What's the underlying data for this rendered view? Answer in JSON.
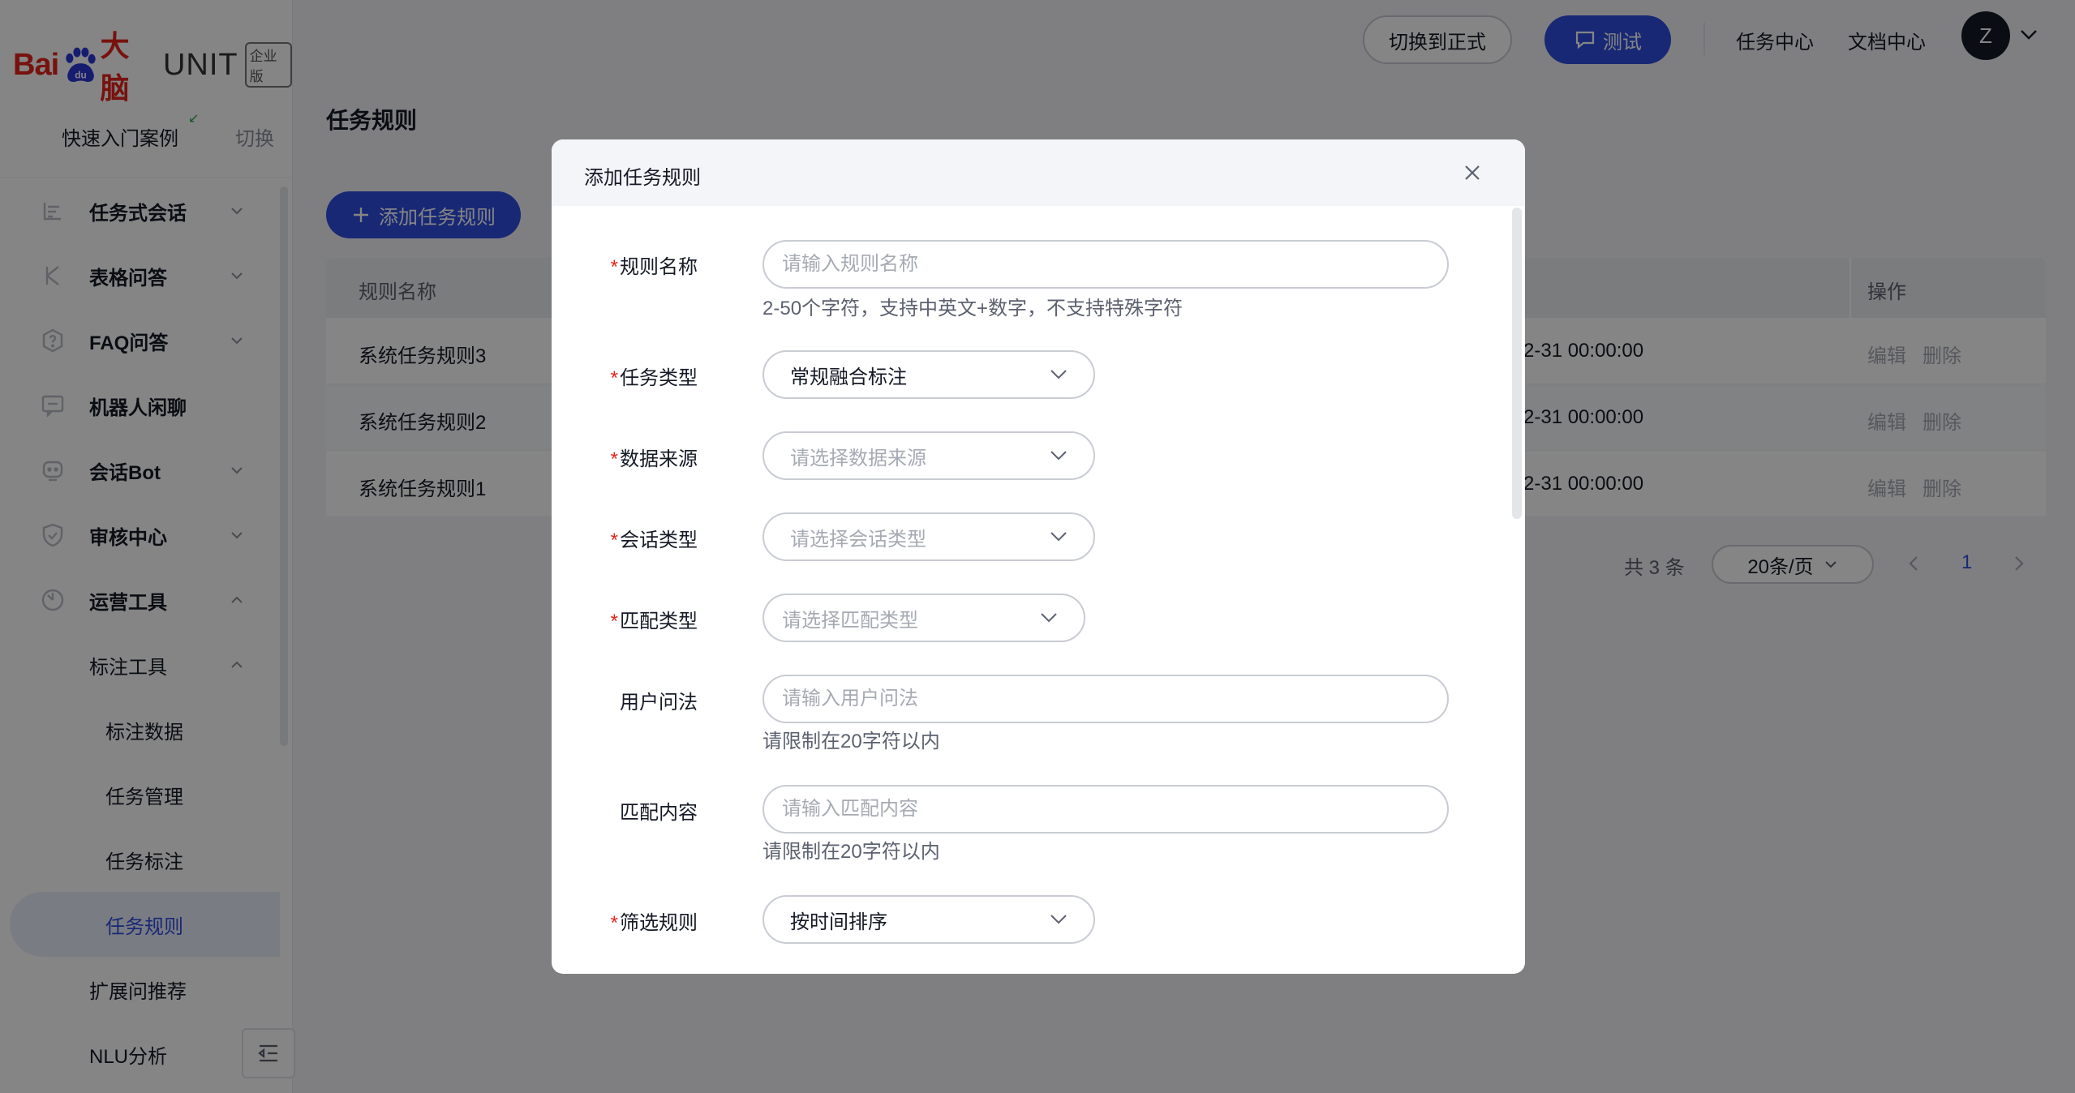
{
  "brand": {
    "logo_bai": "Bai",
    "logo_du": "du",
    "logo_da": "大脑",
    "logo_unit": "UNIT",
    "edition": "企业版"
  },
  "sidebar": {
    "quick_start": "快速入门案例",
    "switch_label": "切换",
    "menu": [
      {
        "label": "任务式会话",
        "icon": "task-dialog-icon",
        "chevron": "down"
      },
      {
        "label": "表格问答",
        "icon": "table-qa-icon",
        "chevron": "down"
      },
      {
        "label": "FAQ问答",
        "icon": "faq-icon",
        "chevron": "down"
      },
      {
        "label": "机器人闲聊",
        "icon": "chat-icon",
        "chevron": "none"
      },
      {
        "label": "会话Bot",
        "icon": "bot-icon",
        "chevron": "down"
      },
      {
        "label": "审核中心",
        "icon": "shield-icon",
        "chevron": "down"
      },
      {
        "label": "运营工具",
        "icon": "ops-tools-icon",
        "chevron": "up"
      },
      {
        "label": "标注工具",
        "chevron": "up"
      },
      {
        "label": "标注数据"
      },
      {
        "label": "任务管理"
      },
      {
        "label": "任务标注"
      },
      {
        "label": "任务规则",
        "active": true
      },
      {
        "label": "扩展问推荐"
      },
      {
        "label": "NLU分析"
      }
    ]
  },
  "header": {
    "switch_prod": "切换到正式",
    "test": "测试",
    "task_center": "任务中心",
    "doc_center": "文档中心",
    "avatar_initial": "Z"
  },
  "main": {
    "title": "任务规则",
    "add_button": "添加任务规则",
    "table": {
      "col_name": "规则名称",
      "col_op": "操作",
      "rows": [
        {
          "name": "系统任务规则3",
          "time": "2-31 00:00:00",
          "edit": "编辑",
          "delete": "删除"
        },
        {
          "name": "系统任务规则2",
          "time": "2-31 00:00:00",
          "edit": "编辑",
          "delete": "删除"
        },
        {
          "name": "系统任务规则1",
          "time": "2-31 00:00:00",
          "edit": "编辑",
          "delete": "删除"
        }
      ]
    },
    "pagination": {
      "total": "共 3 条",
      "page_size": "20条/页",
      "current": "1"
    }
  },
  "modal": {
    "title": "添加任务规则",
    "fields": {
      "rule_name": {
        "label": "规则名称",
        "placeholder": "请输入规则名称",
        "hint": "2-50个字符，支持中英文+数字，不支持特殊字符"
      },
      "task_type": {
        "label": "任务类型",
        "value": "常规融合标注"
      },
      "data_source": {
        "label": "数据来源",
        "placeholder": "请选择数据来源"
      },
      "session_type": {
        "label": "会话类型",
        "placeholder": "请选择会话类型"
      },
      "match_type": {
        "label": "匹配类型",
        "placeholder": "请选择匹配类型"
      },
      "user_query": {
        "label": "用户问法",
        "placeholder": "请输入用户问法",
        "hint": "请限制在20字符以内"
      },
      "match_content": {
        "label": "匹配内容",
        "placeholder": "请输入匹配内容",
        "hint": "请限制在20字符以内"
      },
      "filter_rule": {
        "label": "筛选规则",
        "value": "按时间排序"
      }
    }
  },
  "colors": {
    "primary": "#2f4ee1",
    "brand_red": "#e4241c",
    "text": "#151a26",
    "placeholder": "#a6aab3"
  }
}
